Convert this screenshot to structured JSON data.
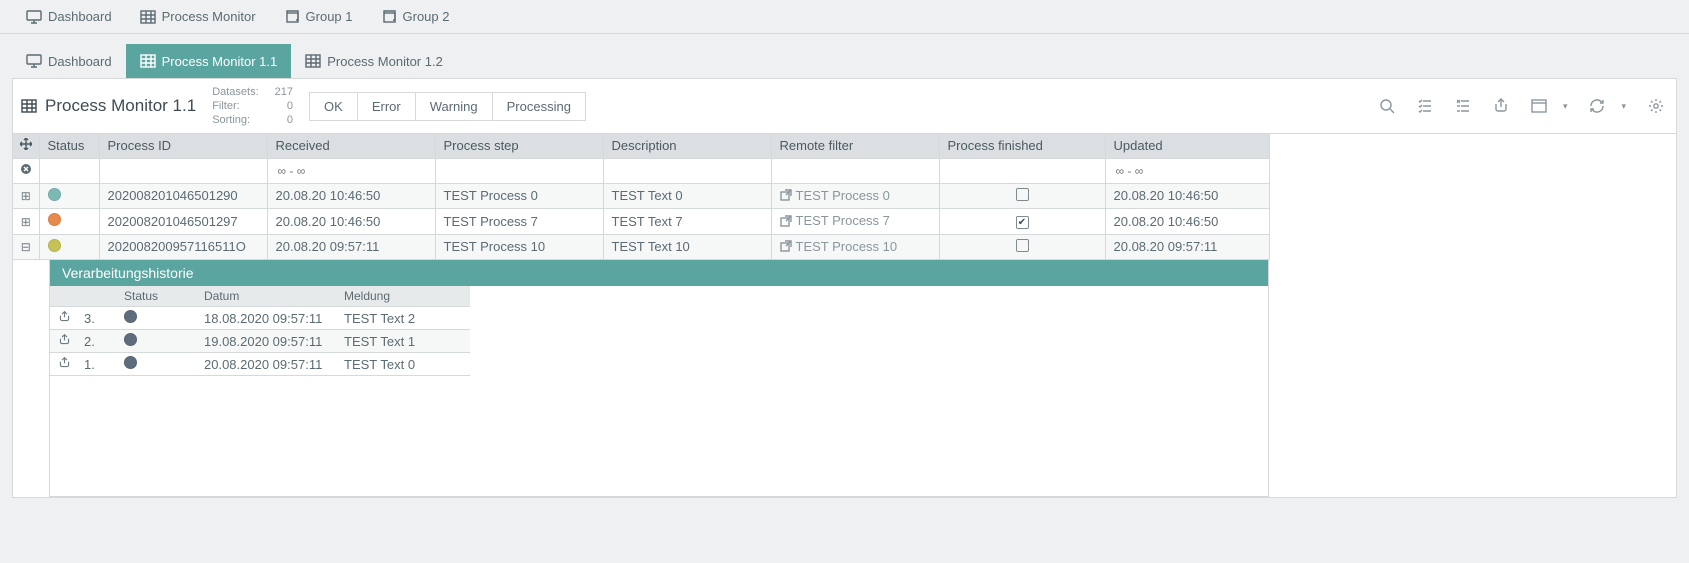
{
  "nav_primary": [
    {
      "label": "Dashboard",
      "icon": "monitor"
    },
    {
      "label": "Process Monitor",
      "icon": "grid"
    },
    {
      "label": "Group 1",
      "icon": "duplicate"
    },
    {
      "label": "Group 2",
      "icon": "duplicate"
    }
  ],
  "nav_secondary": [
    {
      "label": "Dashboard",
      "icon": "monitor",
      "active": false
    },
    {
      "label": "Process Monitor 1.1",
      "icon": "grid",
      "active": true
    },
    {
      "label": "Process Monitor 1.2",
      "icon": "grid",
      "active": false
    }
  ],
  "panel": {
    "title": "Process Monitor 1.1",
    "stats": {
      "datasets_label": "Datasets:",
      "datasets_value": "217",
      "filter_label": "Filter:",
      "filter_value": "0",
      "sorting_label": "Sorting:",
      "sorting_value": "0"
    },
    "status_buttons": [
      "OK",
      "Error",
      "Warning",
      "Processing"
    ]
  },
  "columns": {
    "status": "Status",
    "process_id": "Process ID",
    "received": "Received",
    "process_step": "Process step",
    "description": "Description",
    "remote_filter": "Remote filter",
    "process_finished": "Process finished",
    "updated": "Updated"
  },
  "filter_placeholders": {
    "received": "∞ - ∞",
    "updated": "∞ - ∞"
  },
  "rows": [
    {
      "ctrl": "plus",
      "status_color": "#7cb9b5",
      "process_id": "202008201046501290",
      "received": "20.08.20 10:46:50",
      "process_step": "TEST Process 0",
      "description": "TEST Text 0",
      "remote": "TEST Process 0",
      "finished": false,
      "updated": "20.08.20 10:46:50"
    },
    {
      "ctrl": "plus",
      "status_color": "#e88a4a",
      "process_id": "202008201046501297",
      "received": "20.08.20 10:46:50",
      "process_step": "TEST Process 7",
      "description": "TEST Text 7",
      "remote": "TEST Process 7",
      "finished": true,
      "updated": "20.08.20 10:46:50"
    },
    {
      "ctrl": "minus",
      "status_color": "#c7c255",
      "process_id": "202008200957116511O",
      "received": "20.08.20 09:57:11",
      "process_step": "TEST Process 10",
      "description": "TEST Text 10",
      "remote": "TEST Process 10",
      "finished": false,
      "updated": "20.08.20 09:57:11"
    }
  ],
  "detail": {
    "title": "Verarbeitungshistorie",
    "columns": {
      "status": "Status",
      "datum": "Datum",
      "meldung": "Meldung"
    },
    "rows": [
      {
        "num": "3.",
        "datum": "18.08.2020 09:57:11",
        "meldung": "TEST Text 2"
      },
      {
        "num": "2.",
        "datum": "19.08.2020 09:57:11",
        "meldung": "TEST Text 1"
      },
      {
        "num": "1.",
        "datum": "20.08.2020 09:57:11",
        "meldung": "TEST Text 0"
      }
    ]
  }
}
